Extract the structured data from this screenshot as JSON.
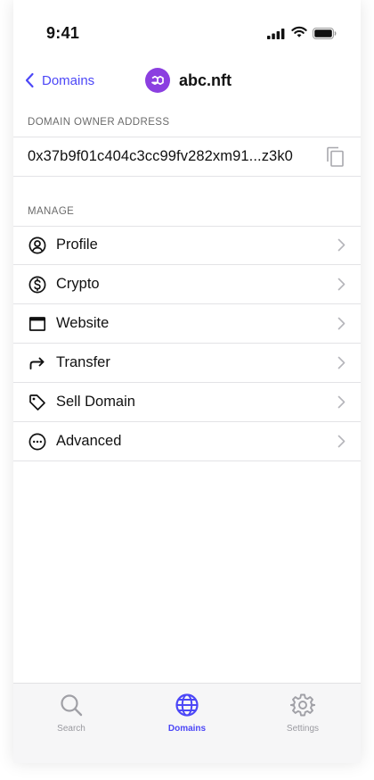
{
  "status_bar": {
    "time": "9:41"
  },
  "nav": {
    "back_label": "Domains",
    "title": "abc.nft"
  },
  "owner_section": {
    "label": "DOMAIN OWNER ADDRESS",
    "address": "0x37b9f01c404c3cc99fv282xm91...z3k0"
  },
  "manage_section": {
    "label": "MANAGE",
    "items": [
      {
        "label": "Profile",
        "icon": "user-circle-icon"
      },
      {
        "label": "Crypto",
        "icon": "dollar-circle-icon"
      },
      {
        "label": "Website",
        "icon": "browser-window-icon"
      },
      {
        "label": "Transfer",
        "icon": "forward-arrow-icon"
      },
      {
        "label": "Sell Domain",
        "icon": "tag-icon"
      },
      {
        "label": "Advanced",
        "icon": "more-circle-icon"
      }
    ]
  },
  "tabs": [
    {
      "label": "Search",
      "icon": "search-icon",
      "active": false
    },
    {
      "label": "Domains",
      "icon": "globe-icon",
      "active": true
    },
    {
      "label": "Settings",
      "icon": "gear-icon",
      "active": false
    }
  ],
  "colors": {
    "accent": "#4c47f7",
    "logo": "#8b3fe0",
    "divider": "#e3e3e6"
  }
}
